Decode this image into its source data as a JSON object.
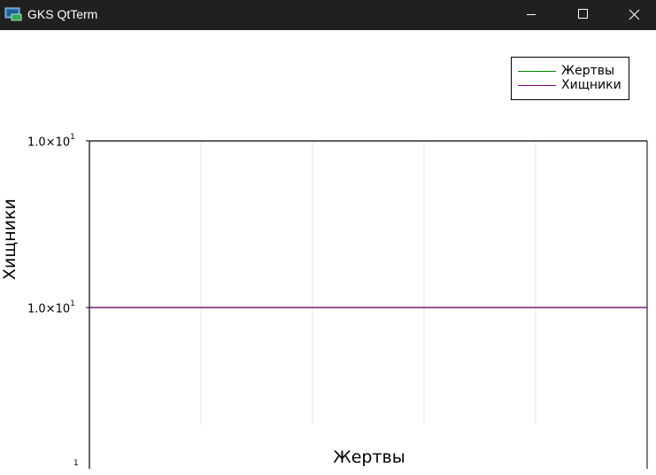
{
  "window": {
    "title": "GKS QtTerm",
    "icon": "gks-qtterm-app-icon",
    "controls": [
      "minimize-icon",
      "maximize-icon",
      "close-icon"
    ]
  },
  "chart_data": {
    "type": "line",
    "xlabel": "Жертвы",
    "ylabel": "Хищники",
    "yscale": "log",
    "ytick_labels": [
      {
        "base": "1.0×10",
        "exp": "1"
      },
      {
        "base": "1.0×10",
        "exp": "1"
      },
      {
        "base": "",
        "exp": "1"
      }
    ],
    "x": [
      0,
      1
    ],
    "series": [
      {
        "name": "Жертвы",
        "color": "#008000",
        "y": [
          10,
          10
        ]
      },
      {
        "name": "Хищники",
        "color": "#800080",
        "y": [
          10,
          10
        ]
      }
    ],
    "grid": true,
    "legend_position": "top-right"
  }
}
